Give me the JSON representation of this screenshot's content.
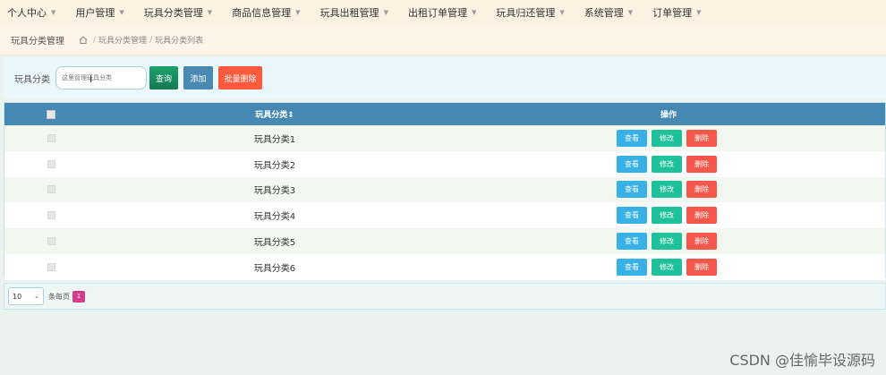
{
  "nav": {
    "items": [
      "个人中心",
      "用户管理",
      "玩具分类管理",
      "商品信息管理",
      "玩具出租管理",
      "出租订单管理",
      "玩具归还管理",
      "系统管理",
      "订单管理"
    ],
    "caret": "▼"
  },
  "breadcrumb": {
    "title": "玩具分类管理",
    "items": [
      "玩具分类管理",
      "玩具分类列表"
    ],
    "separator": "/"
  },
  "search": {
    "label": "玩具分类",
    "placeholder": "这里管理玩具分类",
    "search_label": "查询",
    "add_label": "添加",
    "bulk_delete_label": "批量删除"
  },
  "table": {
    "headers": {
      "name": "玩具分类",
      "ops": "操作"
    },
    "rows": [
      "玩具分类1",
      "玩具分类2",
      "玩具分类3",
      "玩具分类4",
      "玩具分类5",
      "玩具分类6"
    ],
    "ops": {
      "view": "查看",
      "edit": "修改",
      "delete": "删除"
    }
  },
  "pagination": {
    "page_size": "10",
    "per_page_label": "条每页",
    "current_page": "1"
  },
  "watermark": "CSDN @佳愉毕设源码",
  "colors": {
    "nav_bg": "#fdf1e2",
    "table_header": "#4588b2",
    "view": "#38b2e6",
    "edit": "#1fc19a",
    "delete": "#f5584b",
    "bulk_delete": "#ff5a3d",
    "page_active": "#d43c8e"
  }
}
